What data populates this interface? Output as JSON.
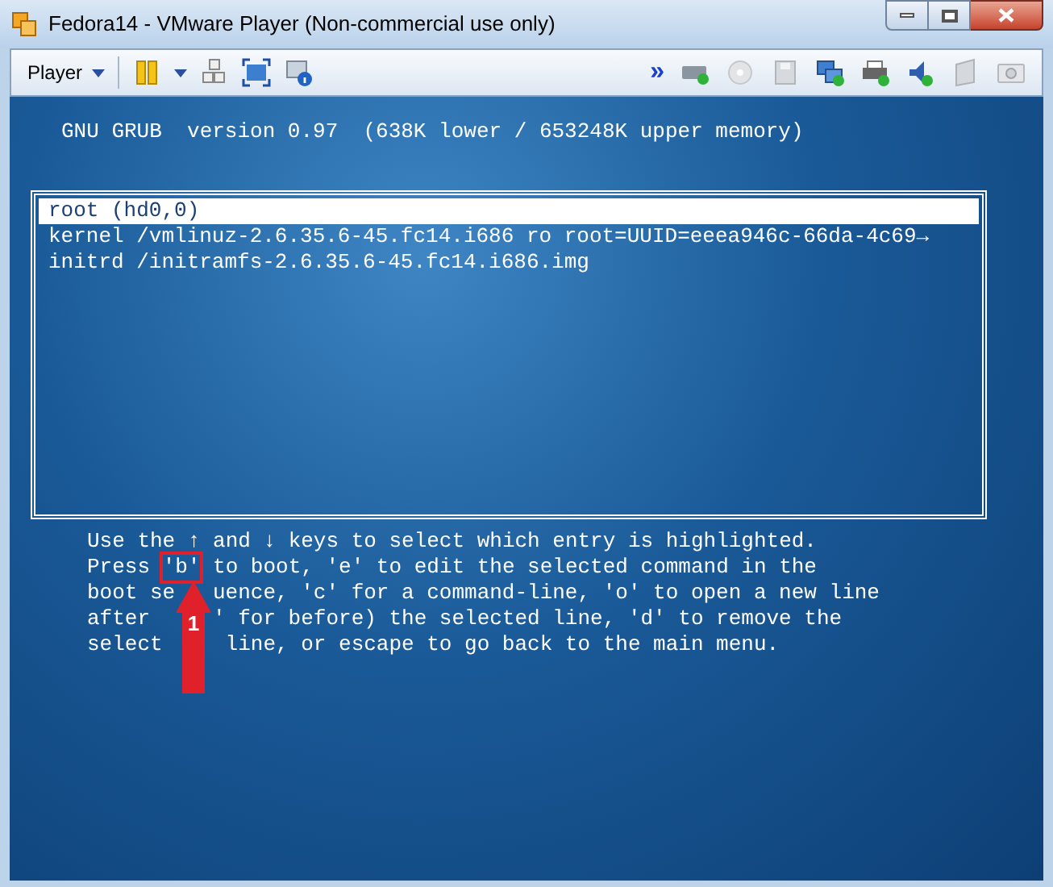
{
  "window": {
    "title": "Fedora14 - VMware Player (Non-commercial use only)"
  },
  "toolbar": {
    "player_menu": "Player",
    "more": "»"
  },
  "grub": {
    "header": "GNU GRUB  version 0.97  (638K lower / 653248K upper memory)",
    "entries": [
      {
        "text": "root (hd0,0)",
        "selected": true
      },
      {
        "text": "kernel /vmlinuz-2.6.35.6-45.fc14.i686 ro root=UUID=eeea946c-66da-4c69→",
        "selected": false
      },
      {
        "text": "initrd /initramfs-2.6.35.6-45.fc14.i686.img",
        "selected": false
      }
    ],
    "help_lines": [
      {
        "kind": "plain",
        "text": "Use the ↑ and ↓ keys to select which entry is highlighted."
      },
      {
        "kind": "boxed",
        "before": "Press ",
        "boxed": "'b'",
        "after": " to boot, 'e' to edit the selected command in the"
      },
      {
        "kind": "split",
        "left": "boot se",
        "right": "uence, 'c' for a command-line, 'o' to open a new line"
      },
      {
        "kind": "split",
        "left": "after",
        "right": "' for before) the selected line, 'd' to remove the"
      },
      {
        "kind": "split",
        "left": "select",
        "right": " line, or escape to go back to the main menu."
      }
    ]
  },
  "annotation": {
    "label": "1"
  }
}
